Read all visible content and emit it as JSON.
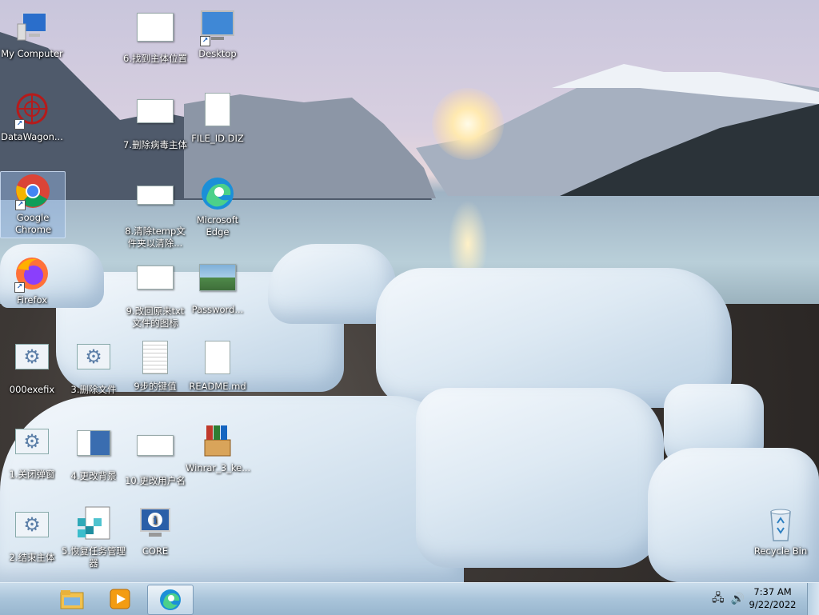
{
  "desktop": {
    "icons": [
      {
        "label": "My Computer",
        "icon": "computer-icon"
      },
      {
        "label": "DataWagon...",
        "icon": "datawagon-icon"
      },
      {
        "label": "Google Chrome",
        "icon": "chrome-icon"
      },
      {
        "label": "Firefox",
        "icon": "firefox-icon"
      },
      {
        "label": "000exefix",
        "icon": "gear-file-icon"
      },
      {
        "label": "1.关闭弹窗",
        "icon": "gear-file-icon"
      },
      {
        "label": "2.结束主体",
        "icon": "gear-file-icon"
      },
      {
        "label": "3.删除文件",
        "icon": "gear-file-icon"
      },
      {
        "label": "4.更改背景",
        "icon": "image-file-icon"
      },
      {
        "label": "5.恢复任务管理器",
        "icon": "registry-icon"
      },
      {
        "label": "6.找到主体位置",
        "icon": "screenshot-icon"
      },
      {
        "label": "7.删除病毒主体",
        "icon": "screenshot-icon"
      },
      {
        "label": "8.清除temp文件夹以清除...",
        "icon": "screenshot-icon"
      },
      {
        "label": "9.改回原来txt文件的图标",
        "icon": "screenshot-icon"
      },
      {
        "label": "9步的键值",
        "icon": "text-file-icon"
      },
      {
        "label": "10.更改用户名",
        "icon": "screenshot-icon"
      },
      {
        "label": "CORE",
        "icon": "info-monitor-icon"
      },
      {
        "label": "Desktop",
        "icon": "desktop-shortcut-icon"
      },
      {
        "label": "FILE_ID.DIZ",
        "icon": "blank-file-icon"
      },
      {
        "label": "Microsoft Edge",
        "icon": "edge-icon"
      },
      {
        "label": "Password...",
        "icon": "picture-icon"
      },
      {
        "label": "README.md",
        "icon": "blank-file-icon"
      },
      {
        "label": "Winrar_3_ke...",
        "icon": "winrar-icon"
      },
      {
        "label": "Recycle Bin",
        "icon": "recycle-bin-icon"
      }
    ]
  },
  "taskbar": {
    "pinned": [
      {
        "name": "file-explorer-icon"
      },
      {
        "name": "media-player-icon"
      },
      {
        "name": "edge-icon"
      }
    ],
    "clock": {
      "time": "7:37 AM",
      "date": "9/22/2022"
    }
  },
  "colors": {
    "taskbar": "#a9c4da",
    "selection": "#96b9e6"
  }
}
